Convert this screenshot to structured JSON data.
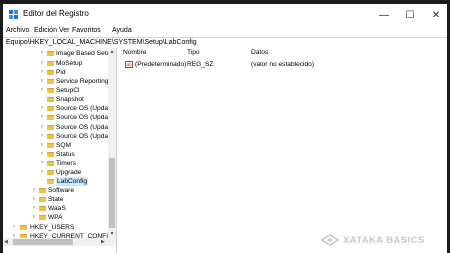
{
  "window": {
    "title": "Editor del Registro"
  },
  "controls": {
    "minimize": "—",
    "maximize": "☐",
    "close": "✕"
  },
  "menu": [
    "Archivo",
    "Edición",
    "Ver",
    "Favoritos",
    "Ayuda"
  ],
  "address": "Equipo\\HKEY_LOCAL_MACHINE\\SYSTEM\\Setup\\LabConfig",
  "tree": [
    {
      "label": "Image Based Setup",
      "expandable": true
    },
    {
      "label": "MoSetup",
      "expandable": true
    },
    {
      "label": "Pid",
      "expandable": true
    },
    {
      "label": "Service Reporting A",
      "expandable": true
    },
    {
      "label": "SetupCl",
      "expandable": true
    },
    {
      "label": "Snapshot",
      "expandable": false
    },
    {
      "label": "Source OS (Update",
      "expandable": true
    },
    {
      "label": "Source OS (Update",
      "expandable": true
    },
    {
      "label": "Source OS (Update",
      "expandable": true
    },
    {
      "label": "Source OS (Update",
      "expandable": true
    },
    {
      "label": "SQM",
      "expandable": true
    },
    {
      "label": "Status",
      "expandable": true
    },
    {
      "label": "Timers",
      "expandable": true
    },
    {
      "label": "Upgrade",
      "expandable": true
    },
    {
      "label": "LabConfig",
      "expandable": false,
      "selected": true
    },
    {
      "label": "Software",
      "expandable": true
    },
    {
      "label": "State",
      "expandable": true
    },
    {
      "label": "WaaS",
      "expandable": true
    },
    {
      "label": "WPA",
      "expandable": true
    },
    {
      "label": "HKEY_USERS",
      "expandable": true
    },
    {
      "label": "HKEY_CURRENT_CONFIG",
      "expandable": true
    }
  ],
  "list": {
    "headers": {
      "name": "Nombre",
      "type": "Tipo",
      "data": "Datos"
    },
    "rows": [
      {
        "icon": "ab",
        "name": "(Predeterminado)",
        "type": "REG_SZ",
        "data": "(valor no establecido)"
      }
    ]
  },
  "watermark": {
    "text": "XATAKA BASICS"
  },
  "colors": {
    "folder": "#e7c64a",
    "selection": "#cce8ff",
    "accent": "#0063b1"
  },
  "icons": {
    "app": "registry-editor-icon",
    "folder": "folder-icon",
    "value": "string-value-icon"
  }
}
